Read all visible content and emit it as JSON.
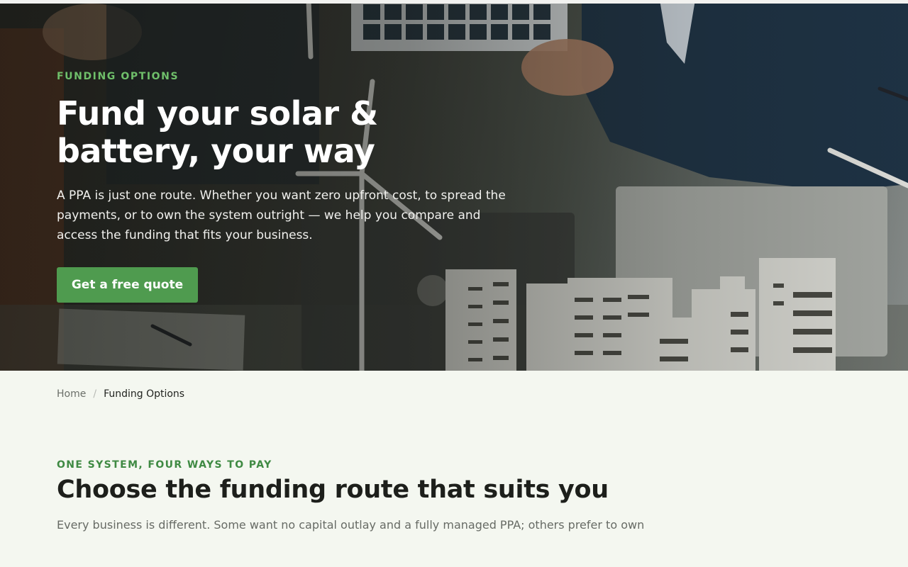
{
  "hero": {
    "eyebrow": "FUNDING OPTIONS",
    "title": "Fund your solar & battery, your way",
    "lead": "A PPA is just one route. Whether you want zero upfront cost, to spread the payments, or to own the system outright — we help you compare and access the funding that fits your business.",
    "cta_label": "Get a free quote"
  },
  "breadcrumb": {
    "home": "Home",
    "separator": "/",
    "current": "Funding Options"
  },
  "section": {
    "eyebrow": "ONE SYSTEM, FOUR WAYS TO PAY",
    "title": "Choose the funding route that suits you",
    "lead": "Every business is different. Some want no capital outlay and a fully managed PPA; others prefer to own"
  },
  "colors": {
    "accent_green": "#4f9b4f",
    "eyebrow_green": "#6fbf6a",
    "page_background": "#f4f7f0"
  },
  "hero_image": {
    "icon": "hero-photo-solar-model-meeting"
  }
}
